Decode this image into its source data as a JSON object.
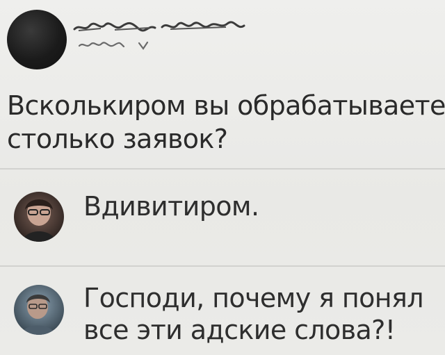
{
  "post": {
    "avatar_icon": "user-avatar-redacted",
    "author_name_redacted": true,
    "question_lines": [
      "Всколькиром вы обрабатываете",
      "столько заявок?"
    ]
  },
  "comments": [
    {
      "avatar_icon": "user-photo-avatar",
      "lines": [
        "Вдивитиром."
      ]
    },
    {
      "avatar_icon": "user-photo-avatar",
      "lines": [
        "Господи, почему я понял",
        "все эти адские слова?!"
      ]
    }
  ],
  "colors": {
    "background": "#ececea",
    "text": "#2b2b2b",
    "divider": "#d2d2cf"
  }
}
